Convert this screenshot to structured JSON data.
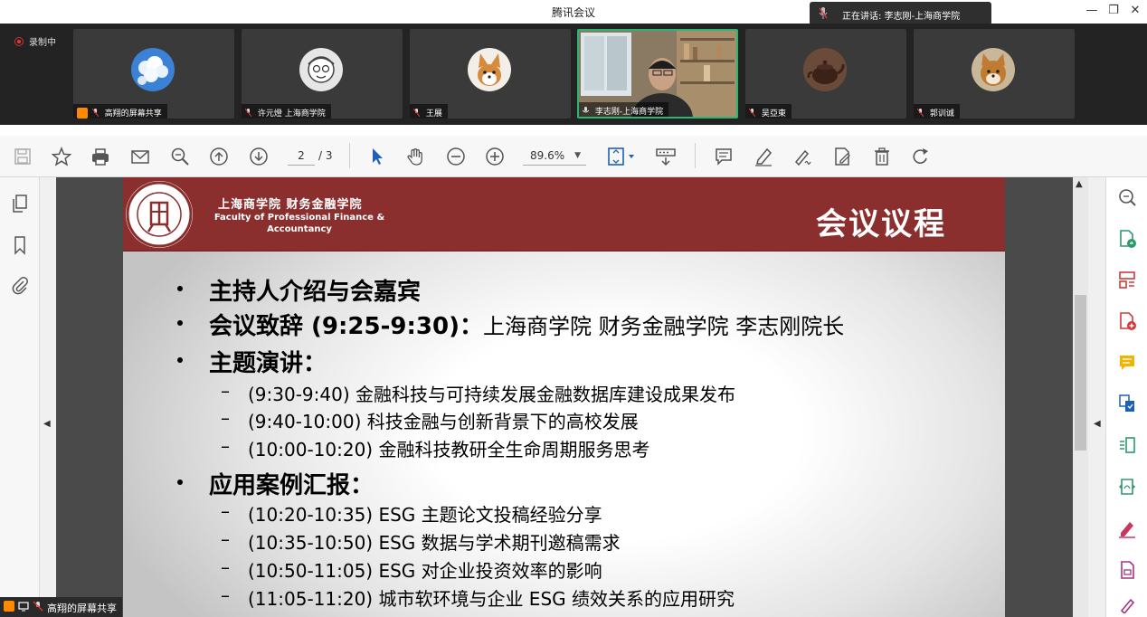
{
  "window": {
    "title": "腾讯会议"
  },
  "speaking": {
    "text": "正在讲话: 李志刚-上海商学院"
  },
  "recording": {
    "label": "录制中"
  },
  "participants": [
    {
      "name": "高翔的屏幕共享",
      "avatar": "sky-clouds"
    },
    {
      "name": "许元燈 上海商学院",
      "avatar": "cartoon-face"
    },
    {
      "name": "王展",
      "avatar": "corgi-dog"
    },
    {
      "name": "李志刚-上海商学院",
      "avatar": "video-feed",
      "active": true
    },
    {
      "name": "吴亞東",
      "avatar": "teapot"
    },
    {
      "name": "郭训诚",
      "avatar": "shiba-dog"
    }
  ],
  "toolbar": {
    "page_current": "2",
    "page_total": "/ 3",
    "zoom": "89.6%"
  },
  "slide": {
    "institution_cn": "上海商学院 财务金融学院",
    "institution_en": "Faculty of Professional Finance & Accountancy",
    "title": "会议议程",
    "items": [
      {
        "level": 1,
        "text": "主持人介绍与会嘉宾"
      },
      {
        "level": 1,
        "text": "会议致辞 (9:25-9:30)：",
        "detail": "上海商学院 财务金融学院 李志刚院长"
      },
      {
        "level": 1,
        "text": "主题演讲："
      },
      {
        "level": 2,
        "text": "(9:30-9:40) 金融科技与可持续发展金融数据库建设成果发布"
      },
      {
        "level": 2,
        "text": "(9:40-10:00) 科技金融与创新背景下的高校发展"
      },
      {
        "level": 2,
        "text": "(10:00-10:20) 金融科技教研全生命周期服务思考"
      },
      {
        "level": 1,
        "text": "应用案例汇报："
      },
      {
        "level": 2,
        "text": "(10:20-10:35) ESG 主题论文投稿经验分享"
      },
      {
        "level": 2,
        "text": "(10:35-10:50) ESG 数据与学术期刊邀稿需求"
      },
      {
        "level": 2,
        "text": "(10:50-11:05) ESG 对企业投资效率的影响"
      },
      {
        "level": 2,
        "text": "(11:05-11:20) 城市软环境与企业 ESG 绩效关系的应用研究"
      }
    ]
  },
  "bottom_share": {
    "label": "高翔的屏幕共享"
  },
  "colors": {
    "slide_header": "#8b2e2e",
    "accent_blue": "#1e6bd6",
    "active_tile": "#2bb673"
  }
}
